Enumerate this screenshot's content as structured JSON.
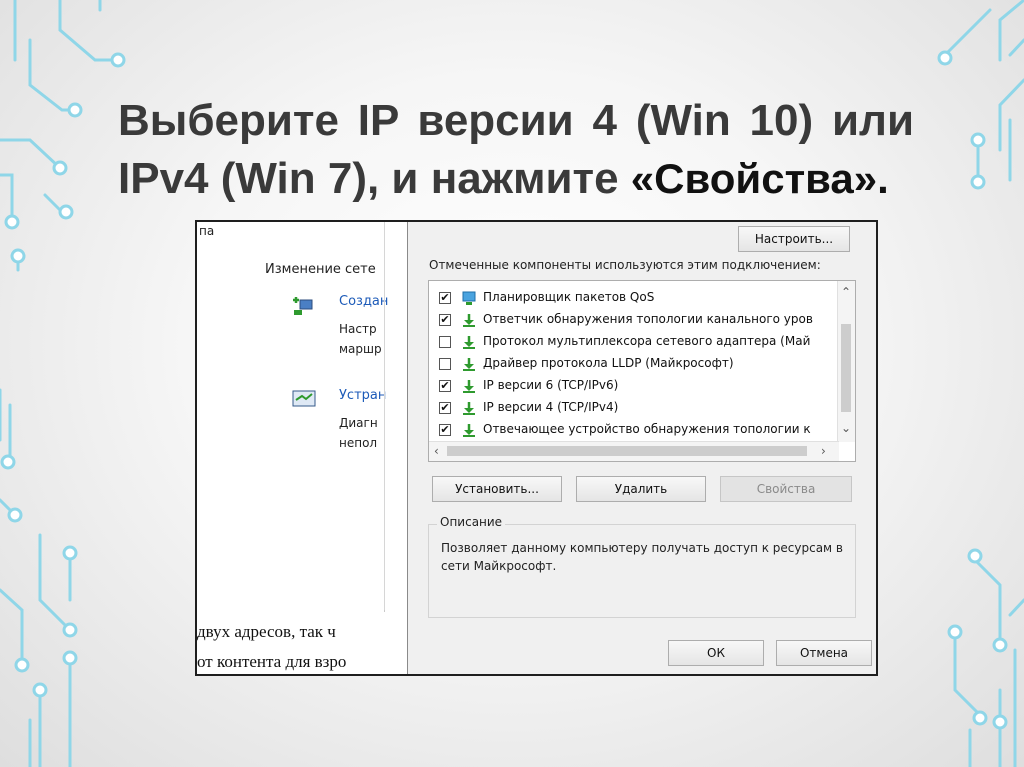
{
  "slide": {
    "title_line1": "Выберите IP версии 4 (Win 10) или",
    "title_line2_prefix": "IPv4 (Win 7),  и нажмите ",
    "title_line2_strong": "«Свойства»."
  },
  "background_window": {
    "fragment_top": "па",
    "heading": "Изменение сете",
    "item1_link": "Создан",
    "item1_line1": "Настр",
    "item1_line2": "маршр",
    "item2_link": "Устран",
    "item2_line1": "Диагн",
    "item2_line2": "непол",
    "text_line1": "двух адресов, так ч",
    "text_line2": "от контента для взро"
  },
  "dialog": {
    "configure_label": "Настроить...",
    "components_label": "Отмеченные компоненты используются этим подключением:",
    "components": [
      {
        "checked": true,
        "label": "Планировщик пакетов QoS",
        "icon": "qos-icon"
      },
      {
        "checked": true,
        "label": "Ответчик обнаружения топологии канального уров",
        "icon": "protocol-icon"
      },
      {
        "checked": false,
        "label": "Протокол мультиплексора сетевого адаптера (Май",
        "icon": "protocol-icon"
      },
      {
        "checked": false,
        "label": "Драйвер протокола LLDP (Майкрософт)",
        "icon": "protocol-icon"
      },
      {
        "checked": true,
        "label": "IP версии 6 (TCP/IPv6)",
        "icon": "protocol-icon"
      },
      {
        "checked": true,
        "label": "IP версии 4 (TCP/IPv4)",
        "icon": "protocol-icon",
        "highlighted": true
      },
      {
        "checked": true,
        "label": "Отвечающее устройство обнаружения топологии к",
        "icon": "protocol-icon"
      }
    ],
    "install_label": "Установить...",
    "remove_label": "Удалить",
    "properties_label": "Свойства",
    "description_legend": "Описание",
    "description_text": "Позволяет данному компьютеру получать доступ к ресурсам в сети Майкрософт.",
    "ok_label": "ОК",
    "cancel_label": "Отмена"
  },
  "colors": {
    "highlight": "#d6212a",
    "circuit": "#8fd6e8",
    "link": "#1c5ab8",
    "protocol_icon": "#2e9a2e"
  }
}
